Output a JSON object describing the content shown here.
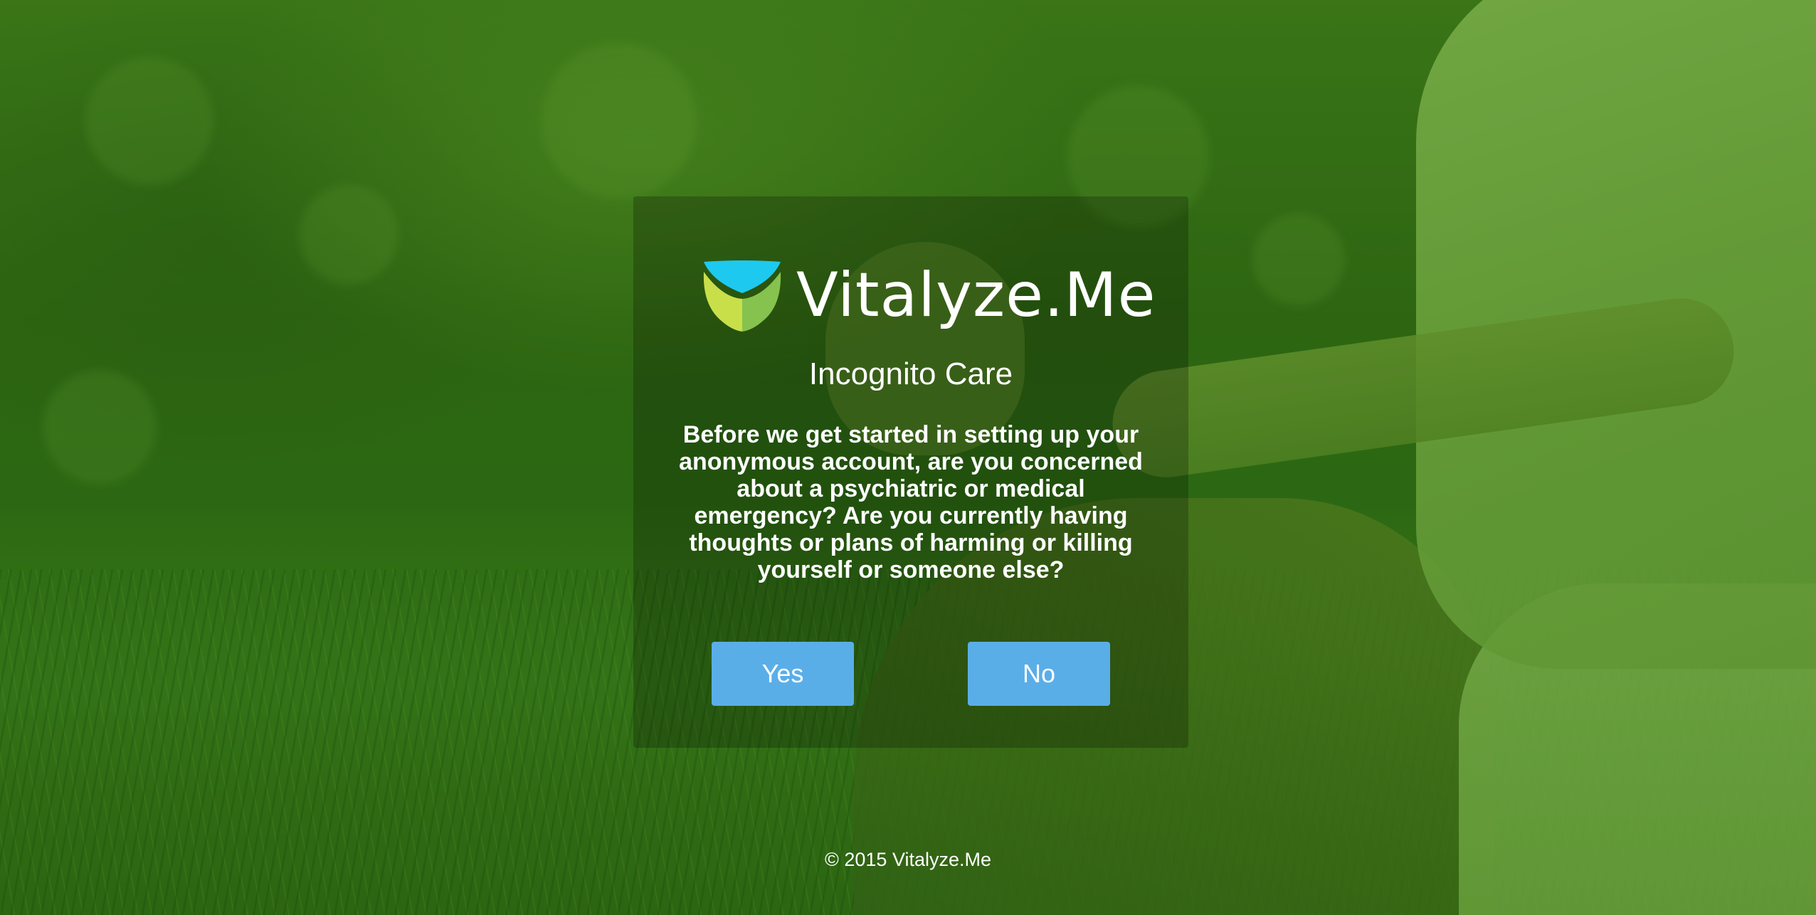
{
  "brand": {
    "name": "Vitalyze.Me",
    "logo_icon": "leaf-drop-logo-icon",
    "colors": {
      "logo_top": "#1ec9ef",
      "logo_left": "#c8df4a",
      "logo_right": "#86c24e",
      "button": "#5aaee8"
    }
  },
  "dialog": {
    "title": "Incognito Care",
    "message": "Before we get started in setting up your anonymous account, are you concerned about a psychiatric or medical emergency? Are you currently having thoughts or plans of harming or killing yourself or someone else?",
    "yes_label": "Yes",
    "no_label": "No"
  },
  "footer": {
    "copyright": "© 2015 Vitalyze.Me"
  }
}
